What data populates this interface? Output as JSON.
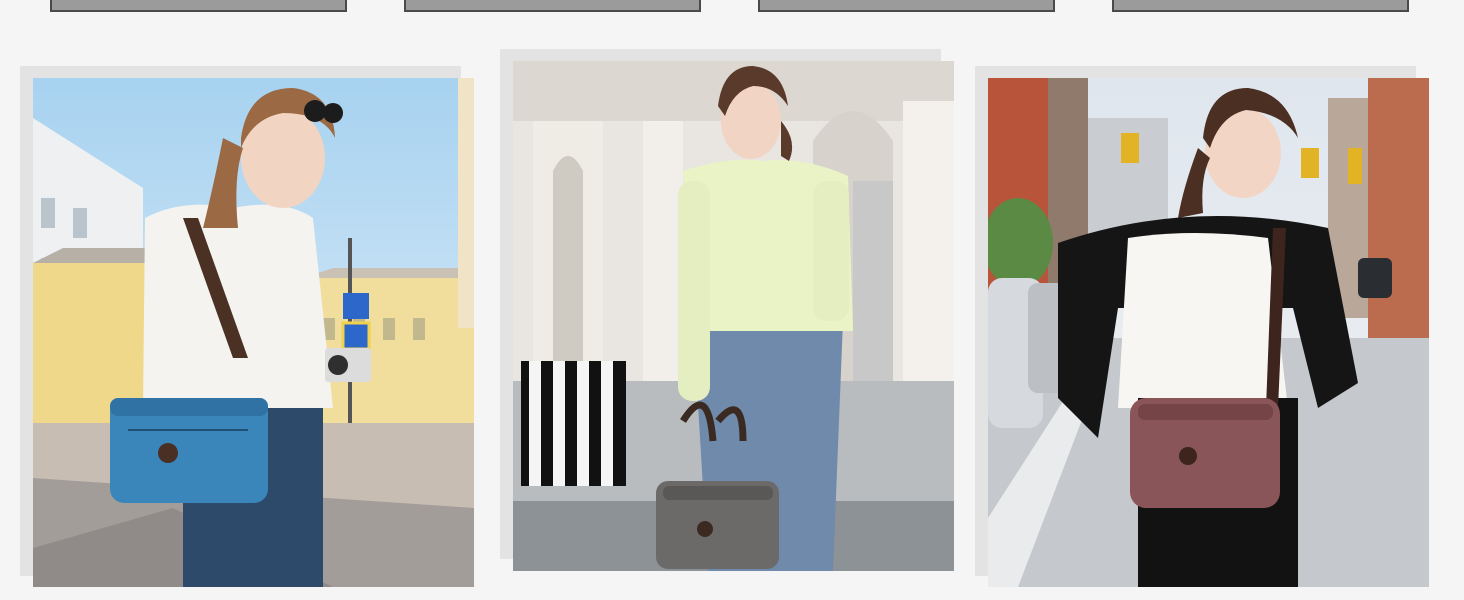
{
  "tabs": [
    {
      "label": ""
    },
    {
      "label": ""
    },
    {
      "label": ""
    },
    {
      "label": ""
    }
  ],
  "photos": [
    {
      "subject": "woman-blue-crossbody-bag-street",
      "bag_color": "#3a86bb"
    },
    {
      "subject": "woman-grey-handbag-arcade",
      "bag_color": "#6c6a68"
    },
    {
      "subject": "woman-burgundy-shoulder-bag-city",
      "bag_color": "#8a5558"
    }
  ],
  "colors": {
    "background": "#f5f5f5",
    "tab_fill": "#9b9b9b",
    "tab_border": "#4a4a4a",
    "frame_shadow": "#e3e3e3"
  }
}
